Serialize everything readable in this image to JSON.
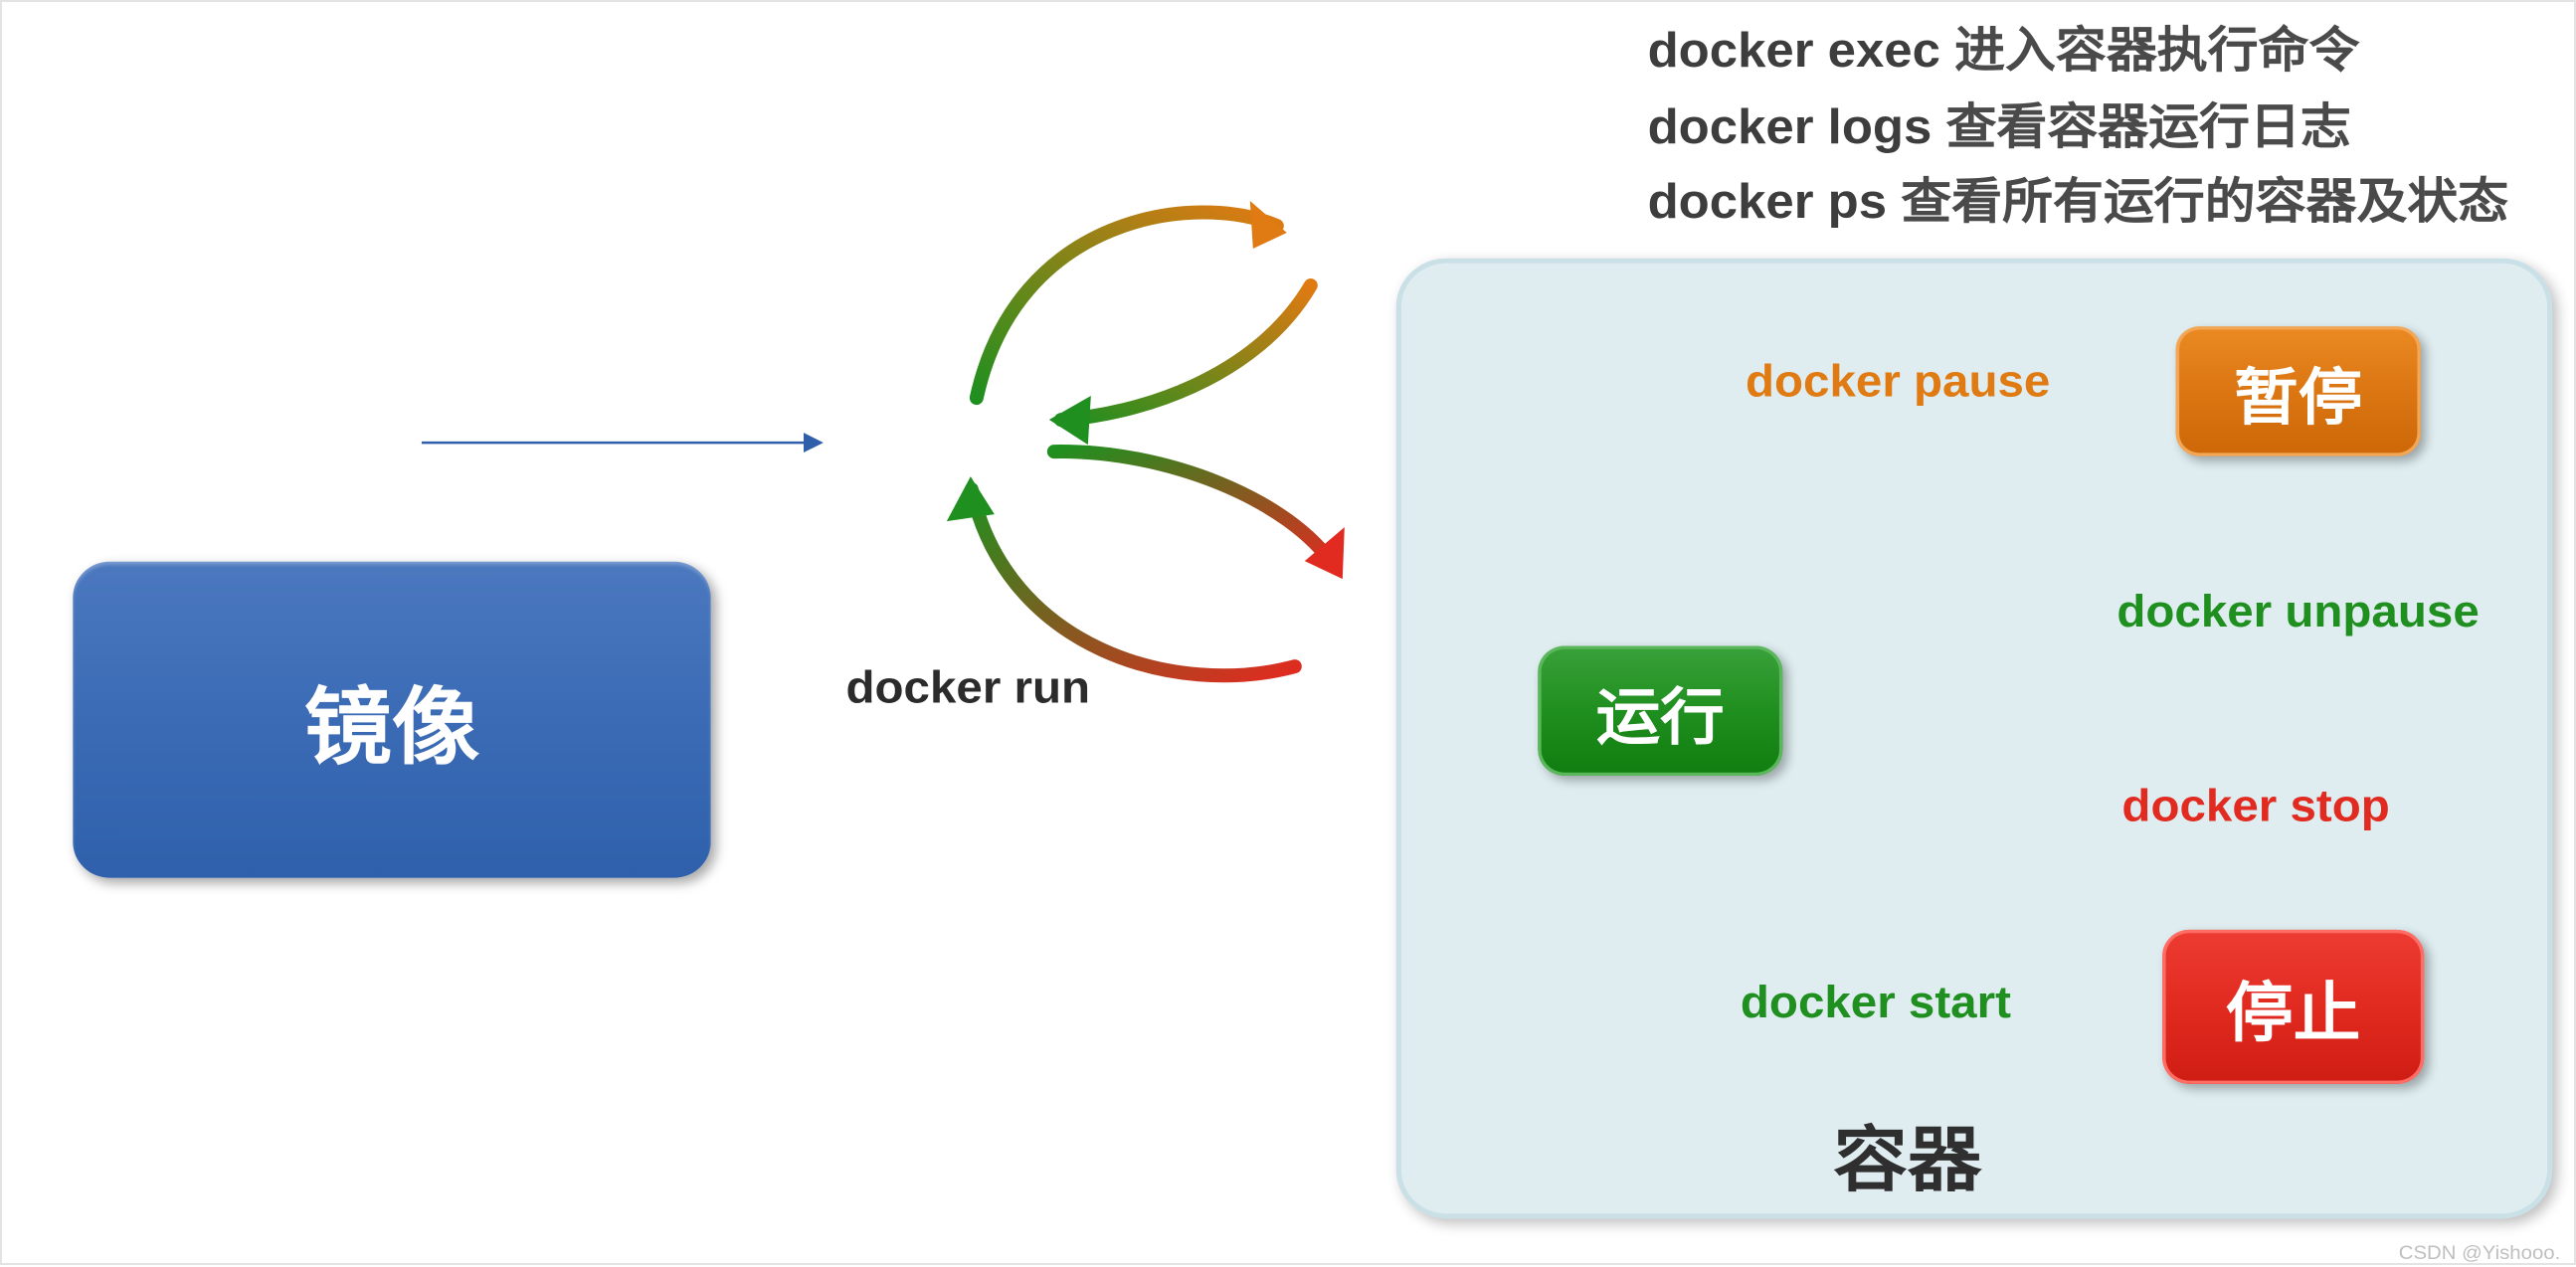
{
  "notes": [
    {
      "cmd": "docker exec",
      "desc": "进入容器执行命令"
    },
    {
      "cmd": "docker logs",
      "desc": "查看容器运行日志"
    },
    {
      "cmd": "docker ps",
      "desc": "查看所有运行的容器及状态"
    }
  ],
  "nodes": {
    "image": "镜像",
    "container": "容器",
    "running": "运行",
    "paused": "暂停",
    "stopped": "停止"
  },
  "edges": {
    "run": "docker run",
    "pause": "docker pause",
    "unpause": "docker unpause",
    "stop": "docker stop",
    "start": "docker start"
  },
  "watermark": "CSDN @Yishooo."
}
